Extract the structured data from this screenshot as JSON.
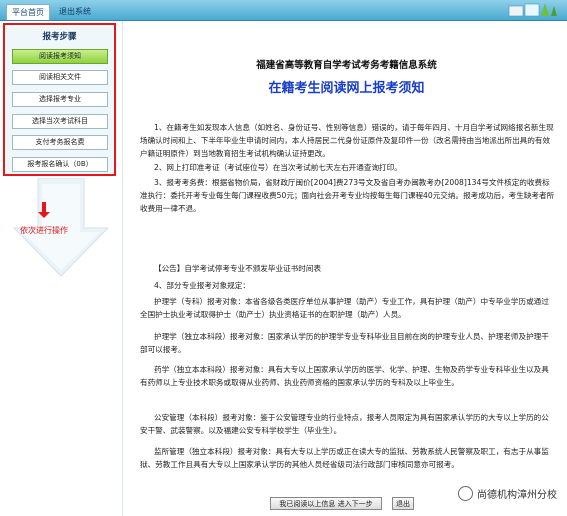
{
  "topbar": {
    "tabs": [
      "平台首页",
      "退出系统"
    ]
  },
  "sidebar": {
    "title": "报考步骤",
    "steps": [
      "阅读报考须知",
      "阅读相关文件",
      "选择报考专业",
      "选择当次考试科目",
      "支付考务报名费",
      "报考报名确认（0B）"
    ],
    "active_index": 0,
    "note": "依次进行操作"
  },
  "main": {
    "system_title": "福建省高等教育自学考试考务考籍信息系统",
    "page_title": "在籍考生阅读网上报考须知",
    "p1": "1、在籍考生如发现本人信息（如姓名、身份证号、性别等信息）错误的，请于每年四月、十月自学考试网络报名新生现场确认时间和上、下半年毕业生申请时间内，本人持居民二代身份证原件及复印件一份（改名需持由当地派出所出具的有效户籍证明原件）到当地教育招生考试机构确认证持更改。",
    "p2": "2、网上打印准考证（考试座位号）在当次考试前七天左右开通查询打印。",
    "p3": "3、报考考务费：根据省物价局，省财政厅闽价[2004]费273号文及省自考办闽教考办[2008]134号文件核定的收费标准执行：委托开考专业每生每门课程收费50元；面向社会开考专业均按每生每门课程40元交纳。报考成功后，考生缺考者所收费用一律不退。",
    "p4": "【公告】自学考试停考专业不颁发毕业证书时间表",
    "p5": "4、部分专业报考对象规定：",
    "p6": "护理学（专科）报考对象：本省各级各类医疗单位从事护理（助产）专业工作，具有护理（助产）中专毕业学历或通过全国护士执业考试取得护士（助产士）执业资格证书的在职护理（助产）人员。",
    "p7": "护理学（独立本科段）报考对象：国家承认学历的护理学专业专科毕业且目前在岗的护理专业人员、护理老师及护理干部可以报考。",
    "p8": "药学（独立本本科段）报考对象：具有大专以上国家承认学历的医学、化学、护理、生物及药学专业专科毕业生以及具有药师以上专业技术职务或取得从业药师、执业药师资格的国家承认学历的专科及以上毕业生。",
    "p9": "公安管理（本科段）报考对象：鉴于公安管理专业的行业特点，报考人员限定为具有国家承认学历的大专以上学历的公安干警、武装警察。以及福建公安专科学校学生（毕业生）。",
    "p10": "监所管理（独立本科段）报考对象：具有大专以上学历或正在读大专的监狱、劳教系统人民警察及职工，有志于从事监狱、劳教工作且具有大专以上国家承认学历的其他人员经省级司法行政部门审核同意亦可报考。",
    "next_button": "我已阅读以上信息 进入下一步",
    "exit_button": "退出"
  },
  "watermark": "尚德机构漳州分校",
  "colors": {
    "accent_red": "#e5171b",
    "title_blue": "#1a3fc7",
    "active_green": "#8fd13e"
  }
}
